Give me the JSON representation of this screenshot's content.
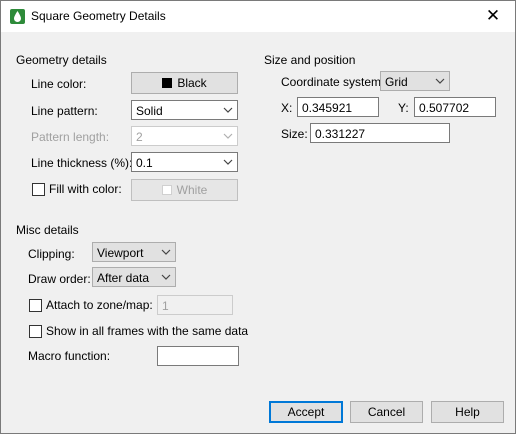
{
  "window": {
    "title": "Square Geometry Details"
  },
  "geometry": {
    "heading": "Geometry details",
    "line_color_label": "Line color:",
    "line_color_value": "Black",
    "line_color_hex": "#000000",
    "line_pattern_label": "Line pattern:",
    "line_pattern_value": "Solid",
    "pattern_length_label": "Pattern length:",
    "pattern_length_value": "2",
    "line_thickness_label": "Line thickness (%):",
    "line_thickness_value": "0.1",
    "fill_label": "Fill with color:",
    "fill_checked": false,
    "fill_color_value": "White",
    "fill_color_hex": "#ffffff"
  },
  "size_position": {
    "heading": "Size and position",
    "coord_system_label": "Coordinate system:",
    "coord_system_value": "Grid",
    "x_label": "X:",
    "x_value": "0.345921",
    "y_label": "Y:",
    "y_value": "0.507702",
    "size_label": "Size:",
    "size_value": "0.331227"
  },
  "misc": {
    "heading": "Misc details",
    "clipping_label": "Clipping:",
    "clipping_value": "Viewport",
    "draw_order_label": "Draw order:",
    "draw_order_value": "After data",
    "attach_label": "Attach to zone/map:",
    "attach_checked": false,
    "attach_value": "1",
    "show_all_frames_label": "Show in all frames with the same data",
    "show_all_frames_checked": false,
    "macro_label": "Macro function:",
    "macro_value": ""
  },
  "buttons": {
    "accept": "Accept",
    "cancel": "Cancel",
    "help": "Help"
  }
}
